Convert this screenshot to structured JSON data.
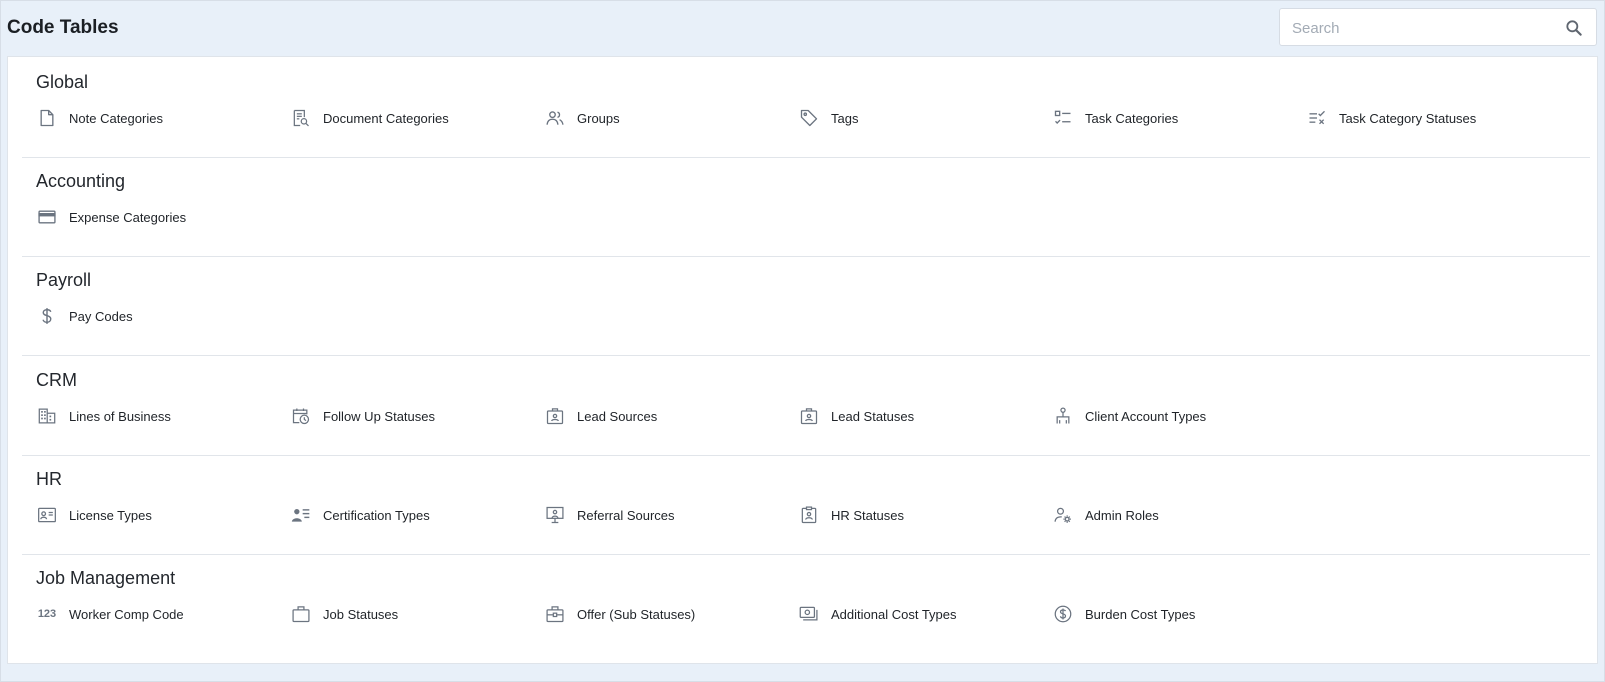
{
  "header": {
    "title": "Code Tables",
    "search_placeholder": "Search",
    "search_value": ""
  },
  "colors": {
    "background": "#e8f0f9",
    "icon": "#6b7480",
    "text": "#1f2328",
    "divider": "#e1e5ea"
  },
  "sections": [
    {
      "title": "Global",
      "items": [
        {
          "label": "Note Categories",
          "icon": "note-icon"
        },
        {
          "label": "Document Categories",
          "icon": "document-search-icon"
        },
        {
          "label": "Groups",
          "icon": "users-icon"
        },
        {
          "label": "Tags",
          "icon": "tag-icon"
        },
        {
          "label": "Task Categories",
          "icon": "checklist-icon"
        },
        {
          "label": "Task Category Statuses",
          "icon": "list-check-x-icon"
        }
      ]
    },
    {
      "title": "Accounting",
      "items": [
        {
          "label": "Expense Categories",
          "icon": "credit-card-icon"
        }
      ]
    },
    {
      "title": "Payroll",
      "items": [
        {
          "label": "Pay Codes",
          "icon": "dollar-icon"
        }
      ]
    },
    {
      "title": "CRM",
      "items": [
        {
          "label": "Lines of Business",
          "icon": "building-icon"
        },
        {
          "label": "Follow Up Statuses",
          "icon": "calendar-clock-icon"
        },
        {
          "label": "Lead Sources",
          "icon": "badge-icon"
        },
        {
          "label": "Lead Statuses",
          "icon": "badge-icon"
        },
        {
          "label": "Client Account Types",
          "icon": "account-tree-icon"
        }
      ]
    },
    {
      "title": "HR",
      "items": [
        {
          "label": "License Types",
          "icon": "id-card-icon"
        },
        {
          "label": "Certification Types",
          "icon": "person-list-icon"
        },
        {
          "label": "Referral Sources",
          "icon": "presentation-person-icon"
        },
        {
          "label": "HR Statuses",
          "icon": "clipboard-person-icon"
        },
        {
          "label": "Admin Roles",
          "icon": "user-gear-icon"
        }
      ]
    },
    {
      "title": "Job Management",
      "items": [
        {
          "label": "Worker Comp Code",
          "icon": "numbers-icon",
          "glyph": "123"
        },
        {
          "label": "Job Statuses",
          "icon": "briefcase-icon"
        },
        {
          "label": "Offer (Sub Statuses)",
          "icon": "briefcase-tools-icon"
        },
        {
          "label": "Additional Cost Types",
          "icon": "money-icon"
        },
        {
          "label": "Burden Cost Types",
          "icon": "dollar-circle-icon"
        }
      ]
    }
  ]
}
